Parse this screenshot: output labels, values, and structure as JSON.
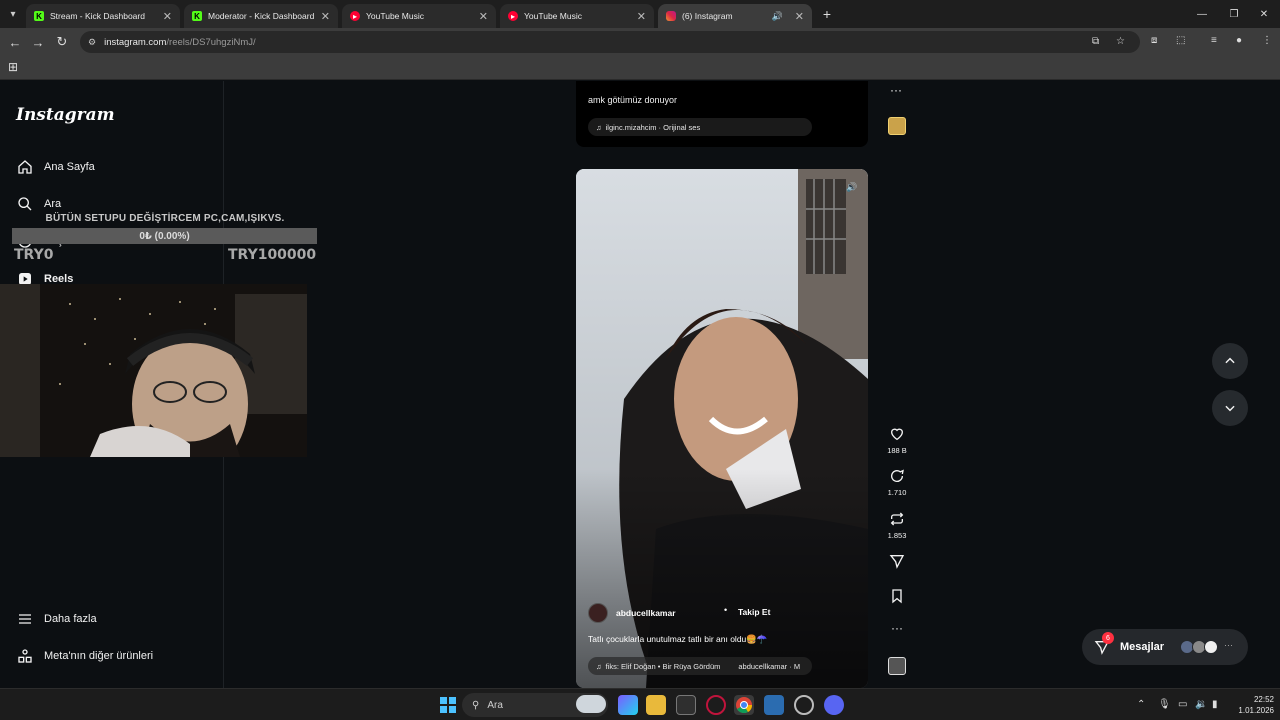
{
  "browser": {
    "tabs": [
      {
        "title": "Stream - Kick Dashboard",
        "favicon": "kick-icon",
        "active": false
      },
      {
        "title": "Moderator - Kick Dashboard",
        "favicon": "kick-icon",
        "active": false
      },
      {
        "title": "YouTube Music",
        "favicon": "youtube-music-icon",
        "active": false
      },
      {
        "title": "YouTube Music",
        "favicon": "youtube-music-icon",
        "active": false
      },
      {
        "title": "(6) Instagram",
        "favicon": "instagram-icon",
        "active": true
      }
    ],
    "url_host": "instagram.com",
    "url_path": "/reels/DS7uhgziNmJ/"
  },
  "sidebar": {
    "logo": "Instagram",
    "items": [
      {
        "label": "Ana Sayfa",
        "icon": "home-icon"
      },
      {
        "label": "Ara",
        "icon": "search-icon"
      },
      {
        "label": "Keşfet",
        "icon": "compass-icon"
      },
      {
        "label": "Reels",
        "icon": "reels-icon"
      }
    ],
    "bottom_items": [
      {
        "label": "Daha fazla",
        "icon": "menu-icon"
      },
      {
        "label": "Meta'nın diğer ürünleri",
        "icon": "meta-products-icon"
      }
    ]
  },
  "stream_overlay": {
    "goal_title": "BÜTÜN SETUPU DEĞİŞTİRCEM PC,CAM,IŞIKVS.",
    "goal_progress_text": "0₺ (0.00%)",
    "goal_progress": 0,
    "goal_min": "TRY0",
    "goal_max": "TRY100000"
  },
  "feed": {
    "previous_reel": {
      "caption": "amk götümüz donuyor",
      "audio": "ilginc.mizahcim · Orijinal ses"
    },
    "current_reel": {
      "author": "abducellkamar",
      "follow_label": "Takip Et",
      "caption": "Tatlı çocuklarla unutulmaz tatlı bir anı oldu🍔☂️",
      "audio_1": "fiks: Elif Doğan • Bir Rüya Gördüm",
      "audio_2": "abducellkamar · M"
    },
    "actions": {
      "likes": "188 B",
      "comments": "1.710",
      "reposts": "1.853"
    }
  },
  "messages": {
    "label": "Mesajlar",
    "badge": "6"
  },
  "taskbar": {
    "search_placeholder": "Ara",
    "time": "22:52",
    "date": "1.01.2026"
  }
}
